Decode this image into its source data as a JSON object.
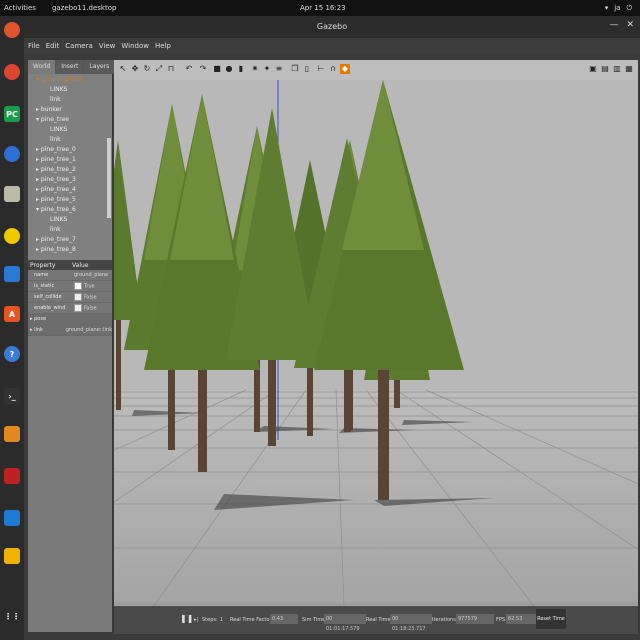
{
  "system": {
    "activities": "Activities",
    "app_menu": "gazebo11.desktop",
    "clock": "Apr 15  16:23",
    "lang": "ja"
  },
  "window": {
    "title": "Gazebo"
  },
  "menu": [
    "File",
    "Edit",
    "Camera",
    "View",
    "Window",
    "Help"
  ],
  "tabs": [
    "World",
    "Insert",
    "Layers"
  ],
  "tree": [
    {
      "label": "ground_plane",
      "color": "#e07b00"
    },
    {
      "label": "LINKS"
    },
    {
      "label": "link"
    },
    {
      "label": "bunker"
    },
    {
      "label": "pine_tree"
    },
    {
      "label": "LINKS"
    },
    {
      "label": "link"
    },
    {
      "label": "pine_tree_0"
    },
    {
      "label": "pine_tree_1"
    },
    {
      "label": "pine_tree_2"
    },
    {
      "label": "pine_tree_3"
    },
    {
      "label": "pine_tree_4"
    },
    {
      "label": "pine_tree_5"
    },
    {
      "label": "pine_tree_6"
    },
    {
      "label": "LINKS"
    },
    {
      "label": "link"
    },
    {
      "label": "pine_tree_7"
    },
    {
      "label": "pine_tree_8"
    }
  ],
  "properties": {
    "header_property": "Property",
    "header_value": "Value",
    "rows": [
      {
        "key": "name",
        "value": "ground_plane"
      },
      {
        "key": "is_static",
        "value": "True"
      },
      {
        "key": "self_collide",
        "value": "False"
      },
      {
        "key": "enable_wind",
        "value": "False"
      },
      {
        "key": "pose",
        "value": ""
      },
      {
        "key": "link",
        "value": "ground_plane::link"
      }
    ]
  },
  "bottom": {
    "steps_label": "Steps:",
    "steps_value": "1",
    "rtf_label": "Real Time Factor:",
    "rtf_value": "0.43",
    "sim_label": "Sim Time:",
    "sim_value": "00 01:01:17.579",
    "real_label": "Real Time:",
    "real_value": "00 01:18:23.717",
    "iter_label": "Iterations:",
    "iter_value": "977579",
    "fps_label": "FPS:",
    "fps_value": "62.53",
    "reset": "Reset Time"
  },
  "colors": {
    "foliage": "#5c7a2e",
    "trunk": "#5a4535",
    "ground": "#a8a8a8",
    "sky": "#b8b8b8"
  }
}
